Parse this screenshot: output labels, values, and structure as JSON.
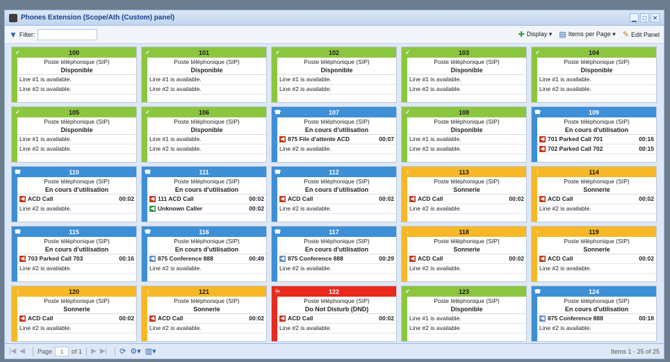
{
  "window": {
    "title": "Phones Extension (Scope/Ath (Custom) panel)",
    "buttons": [
      "▁",
      "□",
      "✕"
    ]
  },
  "toolbar": {
    "filter_label": "Filter:",
    "filter_value": "",
    "display_label": "Display ▾",
    "items_label": "Items per Page ▾",
    "edit_label": "Edit Panel"
  },
  "tiles": [
    {
      "ext": "100",
      "color": "green",
      "type": "Poste téléphonique (SIP)",
      "status": "Disponible",
      "lines": [
        {
          "kind": "text",
          "name": "Line #1 is available.",
          "time": ""
        },
        {
          "kind": "text",
          "name": "Line #2 is available.",
          "time": ""
        }
      ]
    },
    {
      "ext": "101",
      "color": "green",
      "type": "Poste téléphonique (SIP)",
      "status": "Disponible",
      "lines": [
        {
          "kind": "text",
          "name": "Line #1 is available.",
          "time": ""
        },
        {
          "kind": "text",
          "name": "Line #2 is available.",
          "time": ""
        }
      ]
    },
    {
      "ext": "102",
      "color": "green",
      "type": "Poste téléphonique (SIP)",
      "status": "Disponible",
      "lines": [
        {
          "kind": "text",
          "name": "Line #1 is available.",
          "time": ""
        },
        {
          "kind": "text",
          "name": "Line #2 is available.",
          "time": ""
        }
      ]
    },
    {
      "ext": "103",
      "color": "green",
      "type": "Poste téléphonique (SIP)",
      "status": "Disponible",
      "lines": [
        {
          "kind": "text",
          "name": "Line #1 is available.",
          "time": ""
        },
        {
          "kind": "text",
          "name": "Line #2 is available.",
          "time": ""
        }
      ]
    },
    {
      "ext": "104",
      "color": "green",
      "type": "Poste téléphonique (SIP)",
      "status": "Disponible",
      "lines": [
        {
          "kind": "text",
          "name": "Line #1 is available.",
          "time": ""
        },
        {
          "kind": "text",
          "name": "Line #2 is available.",
          "time": ""
        }
      ]
    },
    {
      "ext": "105",
      "color": "green",
      "type": "Poste téléphonique (SIP)",
      "status": "Disponible",
      "lines": [
        {
          "kind": "text",
          "name": "Line #1 is available.",
          "time": ""
        },
        {
          "kind": "text",
          "name": "Line #2 is available.",
          "time": ""
        }
      ]
    },
    {
      "ext": "106",
      "color": "green",
      "type": "Poste téléphonique (SIP)",
      "status": "Disponible",
      "lines": [
        {
          "kind": "text",
          "name": "Line #1 is available.",
          "time": ""
        },
        {
          "kind": "text",
          "name": "Line #2 is available.",
          "time": ""
        }
      ]
    },
    {
      "ext": "107",
      "color": "blue",
      "type": "Poste téléphonique (SIP)",
      "status": "En cours d'utilisation",
      "lines": [
        {
          "kind": "call",
          "name": "875 File d'attente ACD",
          "time": "00:07"
        },
        {
          "kind": "text",
          "name": "Line #2 is available.",
          "time": ""
        }
      ]
    },
    {
      "ext": "108",
      "color": "green",
      "type": "Poste téléphonique (SIP)",
      "status": "Disponible",
      "lines": [
        {
          "kind": "text",
          "name": "Line #1 is available.",
          "time": ""
        },
        {
          "kind": "text",
          "name": "Line #2 is available.",
          "time": ""
        }
      ]
    },
    {
      "ext": "109",
      "color": "blue",
      "type": "Poste téléphonique (SIP)",
      "status": "En cours d'utilisation",
      "lines": [
        {
          "kind": "call",
          "name": "701 Parked Call 701",
          "time": "00:16"
        },
        {
          "kind": "call",
          "name": "702 Parked Call 702",
          "time": "00:15"
        }
      ]
    },
    {
      "ext": "110",
      "color": "blue",
      "type": "Poste téléphonique (SIP)",
      "status": "En cours d'utilisation",
      "lines": [
        {
          "kind": "call",
          "name": "ACD Call",
          "time": "00:02"
        },
        {
          "kind": "text",
          "name": "Line #2 is available.",
          "time": ""
        }
      ]
    },
    {
      "ext": "111",
      "color": "blue",
      "type": "Poste téléphonique (SIP)",
      "status": "En cours d'utilisation",
      "lines": [
        {
          "kind": "call",
          "name": "111 ACD Call",
          "time": "00:02"
        },
        {
          "kind": "unk",
          "name": "Unknown Caller",
          "time": "00:02"
        }
      ]
    },
    {
      "ext": "112",
      "color": "blue",
      "type": "Poste téléphonique (SIP)",
      "status": "En cours d'utilisation",
      "lines": [
        {
          "kind": "call",
          "name": "ACD Call",
          "time": "00:02"
        },
        {
          "kind": "text",
          "name": "Line #2 is available.",
          "time": ""
        }
      ]
    },
    {
      "ext": "113",
      "color": "orange",
      "type": "Poste téléphonique (SIP)",
      "status": "Sonnerie",
      "lines": [
        {
          "kind": "call",
          "name": "ACD Call",
          "time": "00:02"
        },
        {
          "kind": "text",
          "name": "Line #2 is available.",
          "time": ""
        }
      ]
    },
    {
      "ext": "114",
      "color": "orange",
      "type": "Poste téléphonique (SIP)",
      "status": "Sonnerie",
      "lines": [
        {
          "kind": "call",
          "name": "ACD Call",
          "time": "00:02"
        },
        {
          "kind": "text",
          "name": "Line #2 is available.",
          "time": ""
        }
      ]
    },
    {
      "ext": "115",
      "color": "blue",
      "type": "Poste téléphonique (SIP)",
      "status": "En cours d'utilisation",
      "lines": [
        {
          "kind": "call",
          "name": "703 Parked Call 703",
          "time": "00:16"
        },
        {
          "kind": "text",
          "name": "Line #2 is available.",
          "time": ""
        }
      ]
    },
    {
      "ext": "116",
      "color": "blue",
      "type": "Poste téléphonique (SIP)",
      "status": "En cours d'utilisation",
      "lines": [
        {
          "kind": "conf",
          "name": "875 Conference 888",
          "time": "00:49"
        },
        {
          "kind": "text",
          "name": "Line #2 is available.",
          "time": ""
        }
      ]
    },
    {
      "ext": "117",
      "color": "blue",
      "type": "Poste téléphonique (SIP)",
      "status": "En cours d'utilisation",
      "lines": [
        {
          "kind": "conf",
          "name": "875 Conference 888",
          "time": "00:29"
        },
        {
          "kind": "text",
          "name": "Line #2 is available.",
          "time": ""
        }
      ]
    },
    {
      "ext": "118",
      "color": "orange",
      "type": "Poste téléphonique (SIP)",
      "status": "Sonnerie",
      "lines": [
        {
          "kind": "call",
          "name": "ACD Call",
          "time": "00:02"
        },
        {
          "kind": "text",
          "name": "Line #2 is available.",
          "time": ""
        }
      ]
    },
    {
      "ext": "119",
      "color": "orange",
      "type": "Poste téléphonique (SIP)",
      "status": "Sonnerie",
      "lines": [
        {
          "kind": "call",
          "name": "ACD Call",
          "time": "00:02"
        },
        {
          "kind": "text",
          "name": "Line #2 is available.",
          "time": ""
        }
      ]
    },
    {
      "ext": "120",
      "color": "orange",
      "type": "Poste téléphonique (SIP)",
      "status": "Sonnerie",
      "lines": [
        {
          "kind": "call",
          "name": "ACD Call",
          "time": "00:02"
        },
        {
          "kind": "text",
          "name": "Line #2 is available.",
          "time": ""
        }
      ]
    },
    {
      "ext": "121",
      "color": "orange",
      "type": "Poste téléphonique (SIP)",
      "status": "Sonnerie",
      "lines": [
        {
          "kind": "call",
          "name": "ACD Call",
          "time": "00:02"
        },
        {
          "kind": "text",
          "name": "Line #2 is available.",
          "time": ""
        }
      ]
    },
    {
      "ext": "122",
      "color": "red",
      "type": "Poste téléphonique (SIP)",
      "status": "Do Not Disturb (DND)",
      "lines": [
        {
          "kind": "call",
          "name": "ACD Call",
          "time": "00:02"
        },
        {
          "kind": "text",
          "name": "Line #2 is available.",
          "time": ""
        }
      ]
    },
    {
      "ext": "123",
      "color": "green",
      "type": "Poste téléphonique (SIP)",
      "status": "Disponible",
      "lines": [
        {
          "kind": "text",
          "name": "Line #1 is available.",
          "time": ""
        },
        {
          "kind": "text",
          "name": "Line #2 is available.",
          "time": ""
        }
      ]
    },
    {
      "ext": "124",
      "color": "blue",
      "type": "Poste téléphonique (SIP)",
      "status": "En cours d'utilisation",
      "lines": [
        {
          "kind": "conf",
          "name": "875 Conference 888",
          "time": "00:18"
        },
        {
          "kind": "text",
          "name": "Line #2 is available.",
          "time": ""
        }
      ]
    }
  ],
  "pager": {
    "page_label": "Page",
    "page_value": "1",
    "of_label": "of 1",
    "summary": "Items 1 - 25 of 25"
  }
}
